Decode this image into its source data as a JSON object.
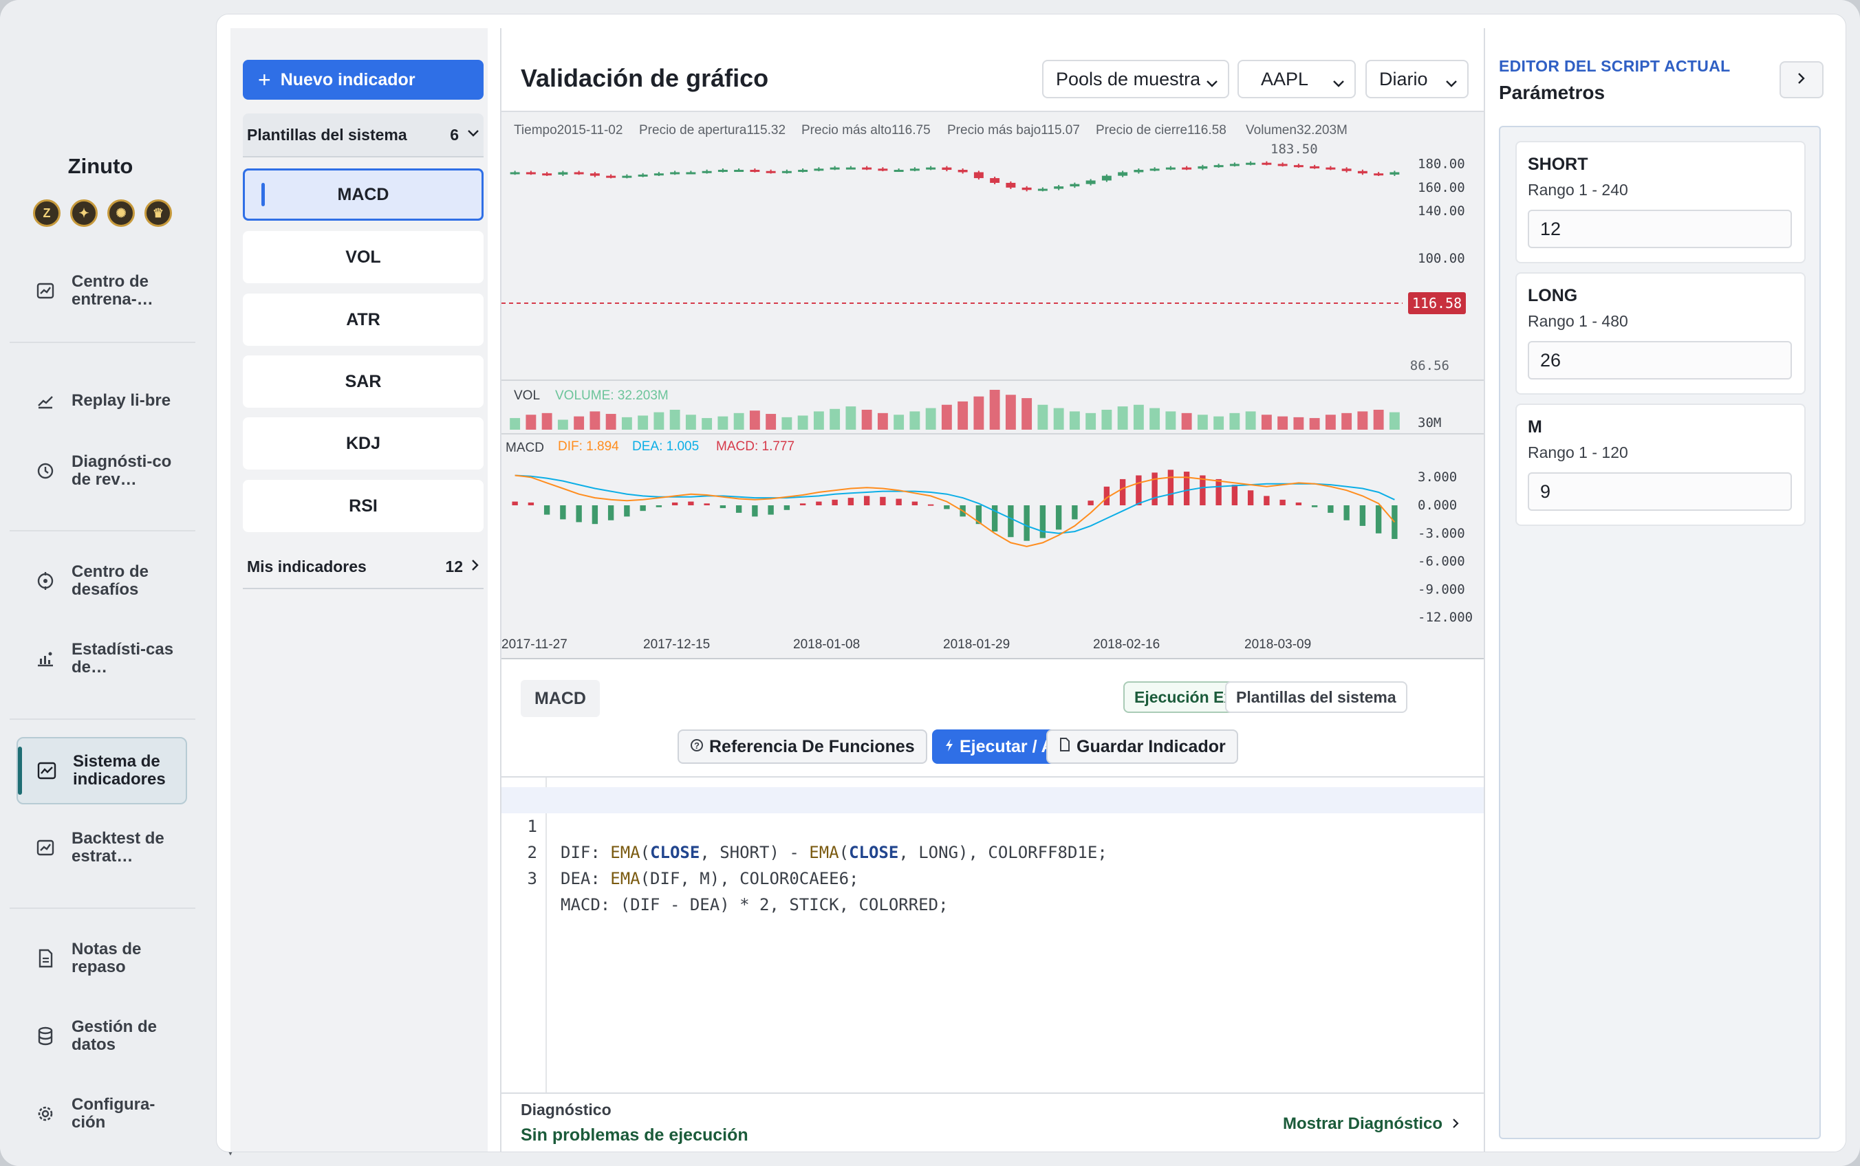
{
  "app": {
    "brand": "Zinuto",
    "brand_icons": [
      {
        "icon": "z-coin-icon",
        "glyph": "Z"
      },
      {
        "icon": "star-coin-icon",
        "glyph": "✦"
      },
      {
        "icon": "gear-coin-icon",
        "glyph": "✺"
      },
      {
        "icon": "crest-coin-icon",
        "glyph": "♛"
      }
    ]
  },
  "nav": {
    "items": [
      {
        "label": "Centro de entrena-…",
        "icon": "image-chart-icon"
      },
      {
        "label": "Replay li-bre",
        "icon": "trend-icon"
      },
      {
        "label": "Diagnósti-co de rev…",
        "icon": "history-icon"
      },
      {
        "label": "Centro de desafíos",
        "icon": "target-icon"
      },
      {
        "label": "Estadísti-cas de…",
        "icon": "stats-icon"
      },
      {
        "label": "Sistema de indicadores",
        "icon": "line-chart-icon",
        "active": true
      },
      {
        "label": "Backtest de estrat…",
        "icon": "image-chart-icon"
      },
      {
        "label": "Notas de repaso",
        "icon": "note-icon"
      },
      {
        "label": "Gestión de datos",
        "icon": "database-icon"
      },
      {
        "label": "Configura-ción",
        "icon": "gear-icon"
      }
    ]
  },
  "indicators": {
    "new_button": "Nuevo indicador",
    "system_group": {
      "label": "Plantillas del sistema",
      "count": "6"
    },
    "items": [
      "MACD",
      "VOL",
      "ATR",
      "SAR",
      "KDJ",
      "RSI"
    ],
    "selected": "MACD",
    "my_group": {
      "label": "Mis indicadores",
      "count": "12"
    }
  },
  "chart": {
    "title": "Validación de gráfico",
    "selectors": {
      "pool": "Pools de muestra",
      "symbol": "AAPL",
      "period": "Diario"
    }
  },
  "chart_data": {
    "type": "candlestick",
    "symbol": "AAPL",
    "info_bar": [
      {
        "label": "Tiempo",
        "value": "2015-11-02"
      },
      {
        "label": "Precio de apertura",
        "value": "115.32"
      },
      {
        "label": "Precio más alto",
        "value": "116.75"
      },
      {
        "label": "Precio más bajo",
        "value": "115.07"
      },
      {
        "label": "Precio de cierre",
        "value": "116.58"
      },
      {
        "label": "Volumen",
        "value": "32.203M"
      }
    ],
    "price_ticks": [
      "180.00",
      "160.00",
      "140.00",
      "100.00"
    ],
    "last_price": "116.58",
    "high_marker": "183.50",
    "low_marker": "86.56",
    "close_series": [
      173,
      172,
      171,
      173,
      172,
      170,
      169,
      170,
      171,
      172,
      173,
      173,
      174,
      175,
      175,
      174,
      173,
      174,
      175,
      176,
      177,
      177,
      176,
      175,
      175,
      176,
      177,
      175,
      173,
      168,
      164,
      160,
      158,
      159,
      161,
      163,
      166,
      170,
      173,
      175,
      176,
      177,
      176,
      178,
      179,
      180,
      181,
      180,
      179,
      178,
      177,
      176,
      174,
      172,
      171,
      173
    ],
    "volume": {
      "label": "VOL",
      "legend": "VOLUME: 32.203M",
      "tick": "30M"
    },
    "volume_series": [
      14,
      18,
      20,
      12,
      16,
      22,
      19,
      15,
      17,
      21,
      24,
      18,
      14,
      16,
      20,
      23,
      19,
      15,
      17,
      22,
      25,
      28,
      24,
      20,
      18,
      22,
      26,
      30,
      34,
      40,
      48,
      42,
      38,
      30,
      26,
      22,
      20,
      24,
      28,
      30,
      26,
      22,
      20,
      18,
      16,
      20,
      22,
      18,
      16,
      15,
      14,
      18,
      20,
      22,
      24,
      21
    ],
    "macd": {
      "label": "MACD",
      "dif_label": "DIF: 1.894",
      "dea_label": "DEA: 1.005",
      "macd_label": "MACD: 1.777",
      "ticks": [
        "3.000",
        "0.000",
        "-3.000",
        "-6.000",
        "-9.000",
        "-12.000"
      ]
    },
    "macd_series": [
      0.4,
      0.3,
      -1.0,
      -1.5,
      -1.8,
      -2.0,
      -1.6,
      -1.2,
      -0.6,
      -0.2,
      0.3,
      0.4,
      0.2,
      -0.3,
      -0.8,
      -1.2,
      -1.0,
      -0.5,
      0.2,
      0.4,
      0.6,
      0.8,
      1.0,
      0.9,
      0.7,
      0.4,
      0.1,
      -0.4,
      -1.2,
      -2.0,
      -2.8,
      -3.4,
      -3.8,
      -3.5,
      -2.6,
      -1.5,
      0.5,
      2.0,
      2.8,
      3.2,
      3.5,
      3.8,
      3.6,
      3.2,
      2.8,
      2.2,
      1.6,
      1.0,
      0.6,
      0.3,
      -0.2,
      -0.8,
      -1.6,
      -2.2,
      -3.0,
      -3.6
    ],
    "dif_series": [
      3.2,
      3.0,
      2.4,
      1.8,
      1.2,
      0.8,
      0.6,
      0.5,
      0.6,
      0.8,
      1.0,
      1.2,
      1.1,
      0.9,
      0.7,
      0.6,
      0.7,
      0.9,
      1.1,
      1.4,
      1.6,
      1.8,
      1.9,
      1.8,
      1.6,
      1.3,
      1.0,
      0.4,
      -0.6,
      -1.8,
      -3.0,
      -4.0,
      -4.4,
      -4.0,
      -3.2,
      -2.2,
      -0.8,
      0.8,
      1.8,
      2.4,
      2.8,
      3.0,
      3.0,
      2.8,
      2.6,
      2.4,
      2.2,
      2.0,
      2.2,
      2.4,
      2.3,
      2.0,
      1.6,
      1.0,
      0.2,
      -1.8
    ],
    "dea_series": [
      3.2,
      3.1,
      2.9,
      2.6,
      2.2,
      1.8,
      1.5,
      1.2,
      1.0,
      0.9,
      0.9,
      0.9,
      1.0,
      1.0,
      0.9,
      0.8,
      0.8,
      0.8,
      0.9,
      1.0,
      1.2,
      1.3,
      1.4,
      1.5,
      1.5,
      1.5,
      1.4,
      1.2,
      0.8,
      0.2,
      -0.6,
      -1.4,
      -2.2,
      -2.8,
      -3.0,
      -2.8,
      -2.2,
      -1.4,
      -0.6,
      0.2,
      0.8,
      1.2,
      1.6,
      1.9,
      2.0,
      2.1,
      2.2,
      2.3,
      2.3,
      2.3,
      2.3,
      2.2,
      2.0,
      1.8,
      1.4,
      0.6
    ],
    "x_ticks": [
      "2017-11-27",
      "2017-12-15",
      "2018-01-08",
      "2018-01-29",
      "2018-02-16",
      "2018-03-09"
    ]
  },
  "editor": {
    "script_name": "MACD",
    "status_pill": "Ejecución Exitosa",
    "templates_pill": "Plantillas del sistema",
    "buttons": {
      "reference": "Referencia De Funciones",
      "run": "Ejecutar / Aplicar",
      "save": "Guardar Indicador"
    },
    "code_lines": [
      {
        "n": "1",
        "text": "DIF: EMA(CLOSE, SHORT) - EMA(CLOSE, LONG), COLORFF8D1E;"
      },
      {
        "n": "2",
        "text": "DEA: EMA(DIF, M), COLOR0CAEE6;"
      },
      {
        "n": "3",
        "text": "MACD: (DIF - DEA) * 2, STICK, COLORRED;"
      }
    ],
    "diagnostic": {
      "title": "Diagnóstico",
      "status": "Sin problemas de ejecución",
      "link": "Mostrar Diagnóstico"
    }
  },
  "params_panel": {
    "title": "EDITOR DEL SCRIPT ACTUAL",
    "subtitle": "Parámetros",
    "params": [
      {
        "name": "SHORT",
        "range": "Rango 1 - 240",
        "value": "12"
      },
      {
        "name": "LONG",
        "range": "Rango 1 - 480",
        "value": "26"
      },
      {
        "name": "M",
        "range": "Rango 1 - 120",
        "value": "9"
      }
    ]
  },
  "colors": {
    "accent": "#2f6fe6",
    "up": "#3e9a6b",
    "down": "#d63a4a",
    "dif": "#ff8d1e",
    "dea": "#0caee6"
  }
}
